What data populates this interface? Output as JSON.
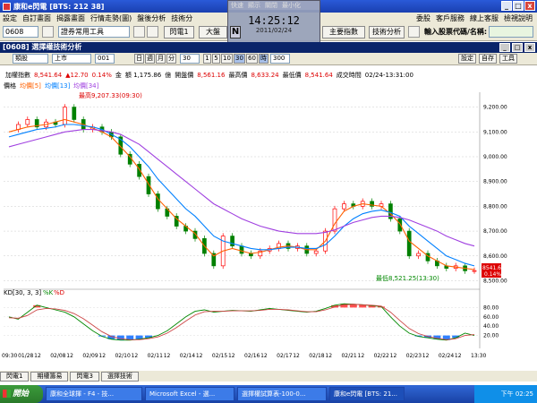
{
  "window": {
    "title": "康和e閃電 [BTS: 212 38]"
  },
  "menu": {
    "items": [
      "設定",
      "自訂畫面",
      "揭露畫面",
      "行情走勢(圖)",
      "盤後分析",
      "技術分"
    ],
    "right_items": [
      "委股",
      "客戶服務",
      "線上客服",
      "檢視說明"
    ]
  },
  "toolbar": {
    "code": "0608",
    "group": "證券常用工具",
    "btn_flash": "閃電1",
    "btn_big": "大盤",
    "btn_indicator": "主要指數",
    "btn_tech": "技術分析",
    "quote_label": "輸入股票代碼/名稱:",
    "quote_value": ""
  },
  "clock": {
    "menu": [
      "快速",
      "顯示",
      "關閉",
      "最小化"
    ],
    "time": "14:25:12",
    "date": "2011/02/24"
  },
  "panel": {
    "title": "[0608] 選擇權技術分析",
    "buttons": [
      "_",
      "□",
      "x"
    ]
  },
  "controls": {
    "type": "類股",
    "market": "上市",
    "code": "001",
    "periods": [
      "日",
      "週",
      "月",
      "分"
    ],
    "period_value": "30",
    "minutes": [
      "1",
      "5",
      "10",
      "30",
      "60",
      "時"
    ],
    "period_count": "300",
    "right_btns": [
      "設定",
      "自存",
      "工具"
    ]
  },
  "info": {
    "name": "加權指數",
    "price": "8,541.64",
    "change": "▲12.70",
    "pct": "0.14%",
    "amount_label": "金",
    "amount": "額 1,175.86",
    "unit": "億",
    "prev_label": "開盤價",
    "prev": "8,561.16",
    "high_label": "最高價",
    "high": "8,633.24",
    "low_label": "最低價",
    "low": "8,541.64",
    "time_label": "成交時間",
    "time": "02/24-13:31:00"
  },
  "legend": {
    "price": "價格",
    "ma5": "均價[5]",
    "ma13": "均價[13]",
    "ma34": "均價[34]"
  },
  "annotations": {
    "high": "最高9,207.33(09:30)",
    "low": "最低8,521.25(13:30)",
    "current_price": "8541.64",
    "current_pct": "0.14%"
  },
  "kd": {
    "label": "KD[30, 3, 3]",
    "k_label": "%K",
    "d_label": "%D",
    "ticks": [
      "80.00",
      "60.00",
      "40.00",
      "20.00"
    ]
  },
  "chart_data": {
    "type": "line",
    "x_labels": [
      "09:30",
      "01/28",
      "12",
      "02/08",
      "12",
      "02/09",
      "12",
      "02/10",
      "12",
      "02/11",
      "12",
      "02/14",
      "12",
      "02/15",
      "12",
      "02/16",
      "12",
      "02/17",
      "12",
      "02/18",
      "12",
      "02/21",
      "12",
      "02/22",
      "12",
      "02/23",
      "12",
      "02/24",
      "12",
      "13:30"
    ],
    "y_ticks": [
      "9,200.00",
      "9,100.00",
      "9,000.00",
      "8,900.00",
      "8,800.00",
      "8,700.00",
      "8,600.00",
      "8,500.00"
    ],
    "ylim": [
      8480,
      9260
    ],
    "series": [
      {
        "name": "價格",
        "values": [
          9110,
          9130,
          9150,
          9120,
          9140,
          9130,
          9200,
          9150,
          9110,
          9120,
          9100,
          9080,
          9010,
          8970,
          8920,
          8850,
          8790,
          8760,
          8720,
          8700,
          8670,
          8610,
          8560,
          8680,
          8640,
          8610,
          8600,
          8620,
          8630,
          8650,
          8630,
          8640,
          8610,
          8620,
          8700,
          8790,
          8810,
          8800,
          8820,
          8800,
          8810,
          8750,
          8700,
          8600,
          8610,
          8580,
          8560,
          8550,
          8560,
          8540,
          8541
        ]
      },
      {
        "name": "均價[5]",
        "values": [
          9100,
          9110,
          9120,
          9125,
          9130,
          9140,
          9150,
          9140,
          9130,
          9115,
          9100,
          9080,
          9040,
          9000,
          8950,
          8890,
          8830,
          8790,
          8750,
          8720,
          8690,
          8640,
          8600,
          8620,
          8630,
          8620,
          8610,
          8615,
          8625,
          8635,
          8640,
          8635,
          8625,
          8625,
          8660,
          8730,
          8780,
          8800,
          8810,
          8805,
          8800,
          8770,
          8730,
          8660,
          8630,
          8600,
          8580,
          8560,
          8555,
          8550,
          8545
        ]
      },
      {
        "name": "均價[13]",
        "values": [
          9080,
          9090,
          9100,
          9110,
          9115,
          9120,
          9130,
          9130,
          9125,
          9120,
          9110,
          9090,
          9070,
          9040,
          9000,
          8960,
          8910,
          8870,
          8830,
          8790,
          8760,
          8720,
          8680,
          8660,
          8650,
          8640,
          8630,
          8625,
          8625,
          8630,
          8635,
          8635,
          8630,
          8630,
          8645,
          8680,
          8720,
          8750,
          8770,
          8780,
          8785,
          8775,
          8760,
          8720,
          8690,
          8660,
          8630,
          8600,
          8585,
          8570,
          8560
        ]
      },
      {
        "name": "均價[34]",
        "values": [
          9040,
          9050,
          9060,
          9070,
          9080,
          9090,
          9100,
          9105,
          9110,
          9110,
          9105,
          9100,
          9090,
          9070,
          9050,
          9020,
          8990,
          8960,
          8930,
          8900,
          8870,
          8840,
          8810,
          8790,
          8770,
          8750,
          8735,
          8720,
          8710,
          8700,
          8695,
          8690,
          8690,
          8690,
          8695,
          8705,
          8720,
          8735,
          8745,
          8755,
          8760,
          8760,
          8755,
          8745,
          8730,
          8715,
          8700,
          8680,
          8665,
          8650,
          8640
        ]
      }
    ]
  },
  "kd_data": {
    "k": [
      60,
      55,
      70,
      85,
      80,
      75,
      70,
      60,
      45,
      30,
      18,
      12,
      10,
      10,
      12,
      15,
      20,
      30,
      45,
      60,
      72,
      75,
      70,
      72,
      74,
      73,
      72,
      75,
      78,
      76,
      74,
      72,
      70,
      72,
      78,
      85,
      88,
      87,
      86,
      84,
      82,
      60,
      40,
      25,
      18,
      15,
      12,
      10,
      15,
      25,
      20
    ],
    "d": [
      58,
      57,
      63,
      75,
      78,
      77,
      74,
      67,
      56,
      42,
      28,
      18,
      13,
      11,
      11,
      13,
      17,
      25,
      37,
      51,
      64,
      71,
      72,
      72,
      73,
      73,
      73,
      74,
      76,
      76,
      75,
      73,
      71,
      71,
      75,
      81,
      86,
      87,
      86,
      85,
      83,
      70,
      52,
      35,
      24,
      18,
      14,
      11,
      13,
      20,
      22
    ]
  },
  "task_buttons": [
    "閃電1",
    "期權籌易",
    "閃電3",
    "選擇技術"
  ],
  "taskbar": {
    "start": "開始",
    "tasks": [
      "康和全球揮 - F4 - 技...",
      "Microsoft Excel - 選...",
      "選擇權試算表-100-0...",
      "康和e閃電 [BTS: 21..."
    ],
    "clock": "下午 02:25"
  },
  "colors": {
    "up": "#ff0000",
    "down": "#008000",
    "ma5": "#ff6000",
    "ma13": "#0080ff",
    "ma34": "#a040e0",
    "kd_fill_high": "#ff5050",
    "kd_fill_low": "#3080ff"
  }
}
